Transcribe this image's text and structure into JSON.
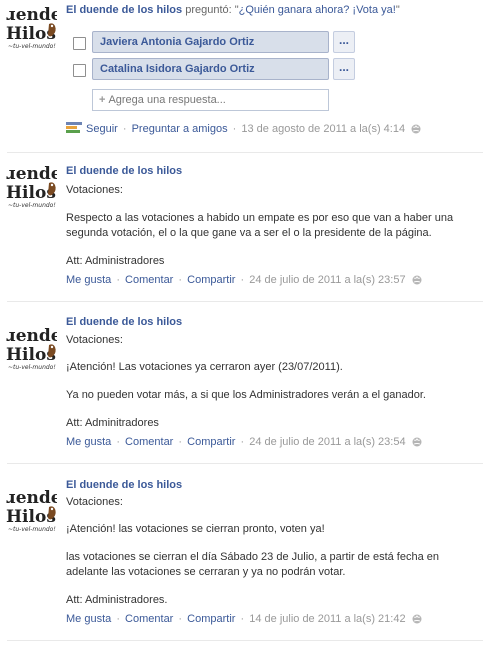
{
  "poll": {
    "author": "El duende de los hilos",
    "verb": "preguntó:",
    "open_quote": "\"",
    "question": "¿Quién ganara ahora? ¡Vota ya!",
    "close_quote": "\"",
    "options": [
      {
        "label": "Javiera Antonia Gajardo Ortiz",
        "more": "..."
      },
      {
        "label": "Catalina Isidora Gajardo Ortiz",
        "more": "..."
      }
    ],
    "add_answer_placeholder": "Agrega una respuesta...",
    "follow_label": "Seguir",
    "ask_friends_label": "Preguntar a amigos",
    "timestamp": "13 de agosto de 2011 a la(s) 4:14"
  },
  "posts": [
    {
      "author": "El duende de los hilos",
      "lines": [
        "Votaciones:",
        "Respecto a las votaciones a habido un empate es por eso que van a haber una",
        "segunda votación, el o la que gane va a ser el o la presidente de la página.",
        "Att: Administradores"
      ],
      "like_label": "Me gusta",
      "comment_label": "Comentar",
      "share_label": "Compartir",
      "timestamp": "24 de julio de 2011 a la(s) 23:57"
    },
    {
      "author": "El duende de los hilos",
      "lines": [
        "Votaciones:",
        "¡Atención! Las votaciones ya cerraron ayer (23/07/2011).",
        "Ya no pueden votar más, a si que los Administradores verán a el ganador.",
        "Att: Adminitradores"
      ],
      "like_label": "Me gusta",
      "comment_label": "Comentar",
      "share_label": "Compartir",
      "timestamp": "24 de julio de 2011 a la(s) 23:54"
    },
    {
      "author": "El duende de los hilos",
      "lines": [
        "Votaciones:",
        "¡Atención! las votaciones se cierran pronto, voten ya!",
        "las votaciones se cierran el día Sábado 23 de Julio, a partir de está fecha en",
        "adelante las votaciones se cerraran y ya no podrán votar.",
        "Att: Administradores."
      ],
      "like_label": "Me gusta",
      "comment_label": "Comentar",
      "share_label": "Compartir",
      "timestamp": "14 de julio de 2011 a la(s) 21:42"
    }
  ],
  "separator": "·",
  "avatar_logo_text": [
    "ɹende",
    "Hilos",
    "~tu-vel-mundo!"
  ],
  "colors": {
    "link": "#3b5998",
    "option_bg": "#d8dfea",
    "meta": "#999999",
    "divider": "#e9e9e9"
  },
  "icons": [
    "poll-icon",
    "globe-icon",
    "avatar-logo-icon"
  ]
}
